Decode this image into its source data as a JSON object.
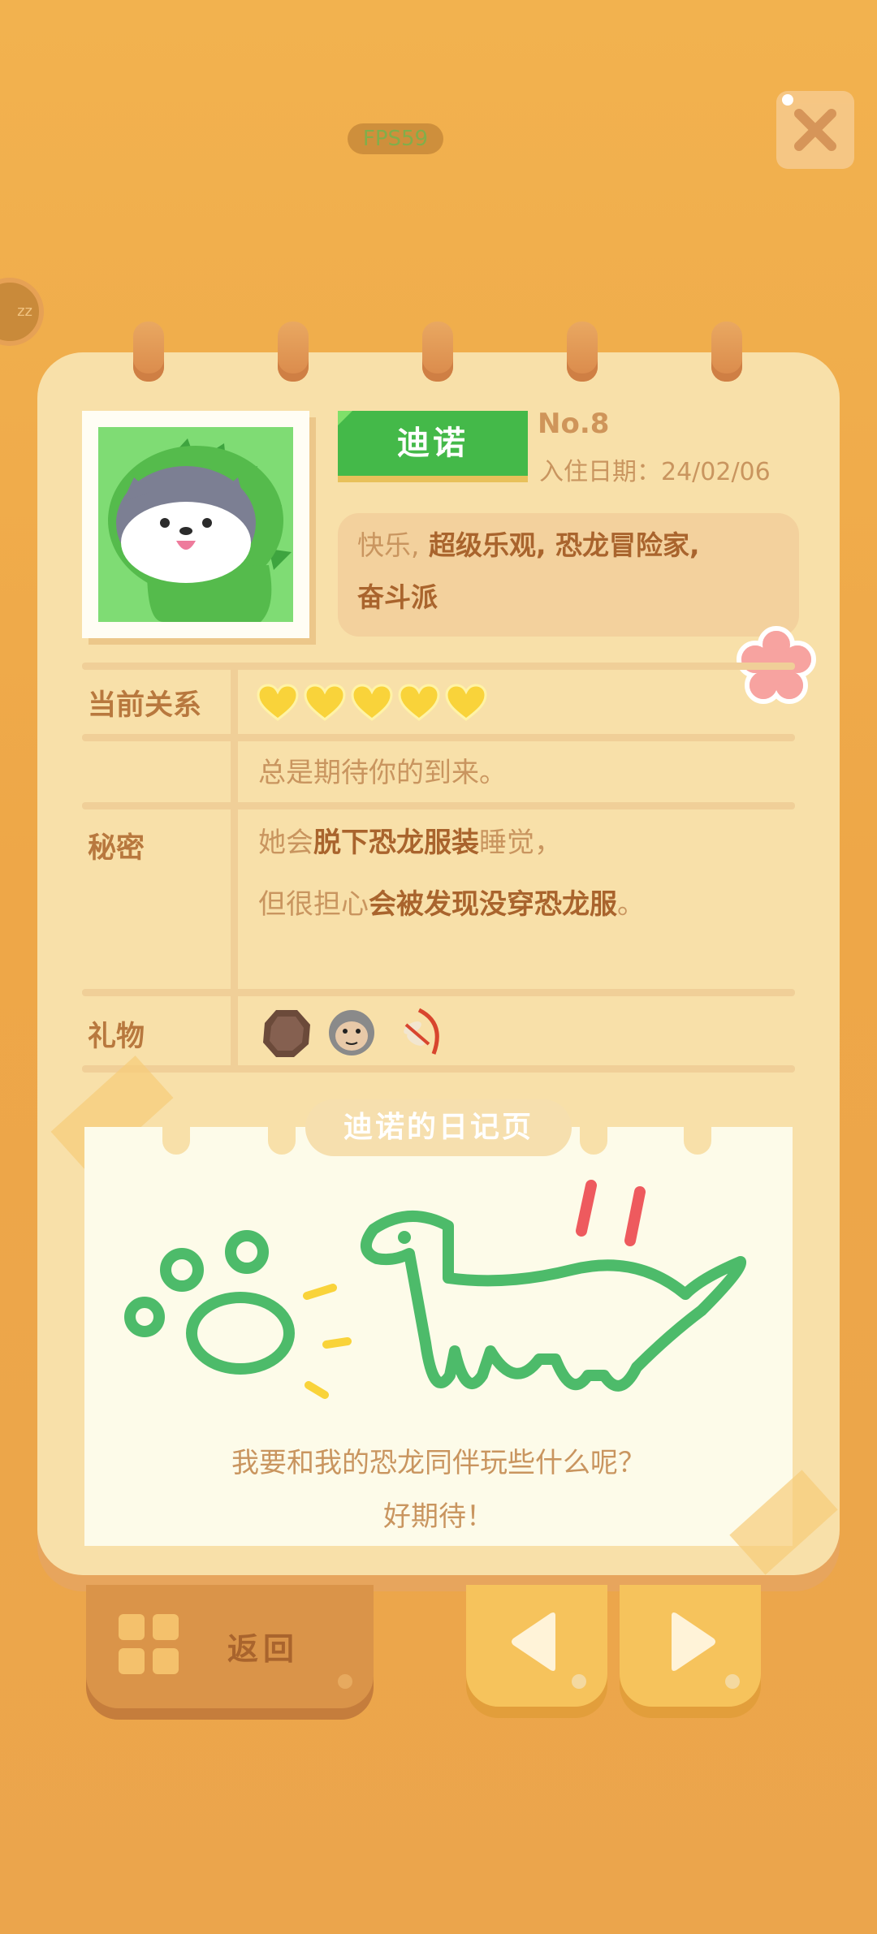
{
  "hud": {
    "fps": "FPS59",
    "close_label": "",
    "side_badge": "zz"
  },
  "profile": {
    "name": "迪诺",
    "number": "No.8",
    "join_date": "入住日期：24/02/06",
    "avatar": "dino-costume-cat-avatar",
    "traits": [
      {
        "text": "快乐,",
        "style": "light"
      },
      {
        "text": " 超级乐观,",
        "style": "bold"
      },
      {
        "text": " 恐龙冒险家,",
        "style": "bold"
      },
      {
        "text": "奋斗派",
        "style": "bold"
      }
    ]
  },
  "relationship": {
    "label": "当前关系",
    "hearts": 5,
    "hearts_max": 5,
    "heart_color": "#f9d33a",
    "description": "总是期待你的到来。"
  },
  "secret": {
    "label": "秘密",
    "line1_a": "她会",
    "line1_b": "脱下恐龙服装",
    "line1_c": "睡觉，",
    "line2_a": "但很担心",
    "line2_b": "会被发现没穿恐龙服",
    "line2_c": "。"
  },
  "gifts": {
    "label": "礼物",
    "items": [
      "chocolate-cookie-icon",
      "gorilla-face-icon",
      "dragonfly-bow-icon"
    ]
  },
  "diary": {
    "title": "迪诺的日记页",
    "caption_line1": "我要和我的恐龙同伴玩些什么呢？",
    "caption_line2": "好期待！"
  },
  "footer": {
    "back_label": "返回",
    "prev_icon": "left-arrow-icon",
    "next_icon": "right-arrow-icon"
  },
  "colors": {
    "background": "#eea748",
    "notebook": "#f8e0a9",
    "name_tag": "#44b949",
    "text_brown": "#b8783e",
    "button_yellow": "#f6c35c"
  }
}
